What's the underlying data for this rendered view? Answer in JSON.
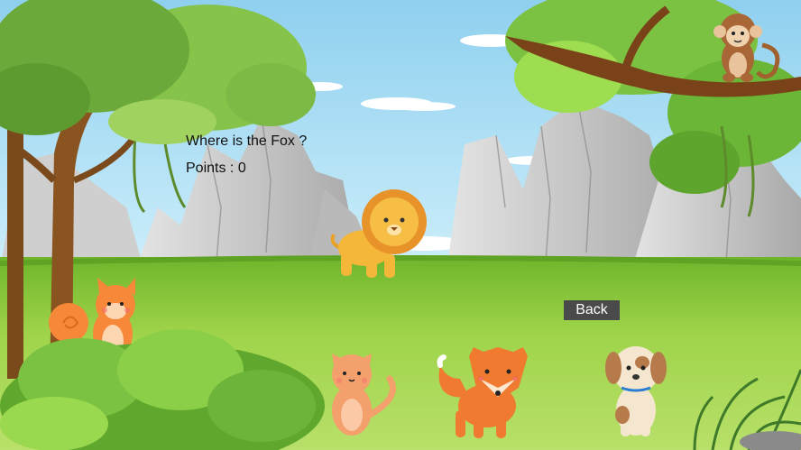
{
  "game": {
    "question": "Where is the Fox ?",
    "points_label": "Points :",
    "points_value": "0",
    "back_label": "Back"
  },
  "animals": [
    {
      "name": "monkey",
      "location": "tree-branch"
    },
    {
      "name": "lion",
      "location": "meadow-center"
    },
    {
      "name": "squirrel",
      "location": "left-bush"
    },
    {
      "name": "cat",
      "location": "bottom"
    },
    {
      "name": "fox",
      "location": "bottom"
    },
    {
      "name": "dog",
      "location": "bottom-right"
    }
  ],
  "colors": {
    "sky": "#9fd6f0",
    "grass": "#8ccc3a",
    "rock": "#c9c9c9",
    "tree_leaves": "#7cc242",
    "button_bg": "#4a4a4a"
  }
}
